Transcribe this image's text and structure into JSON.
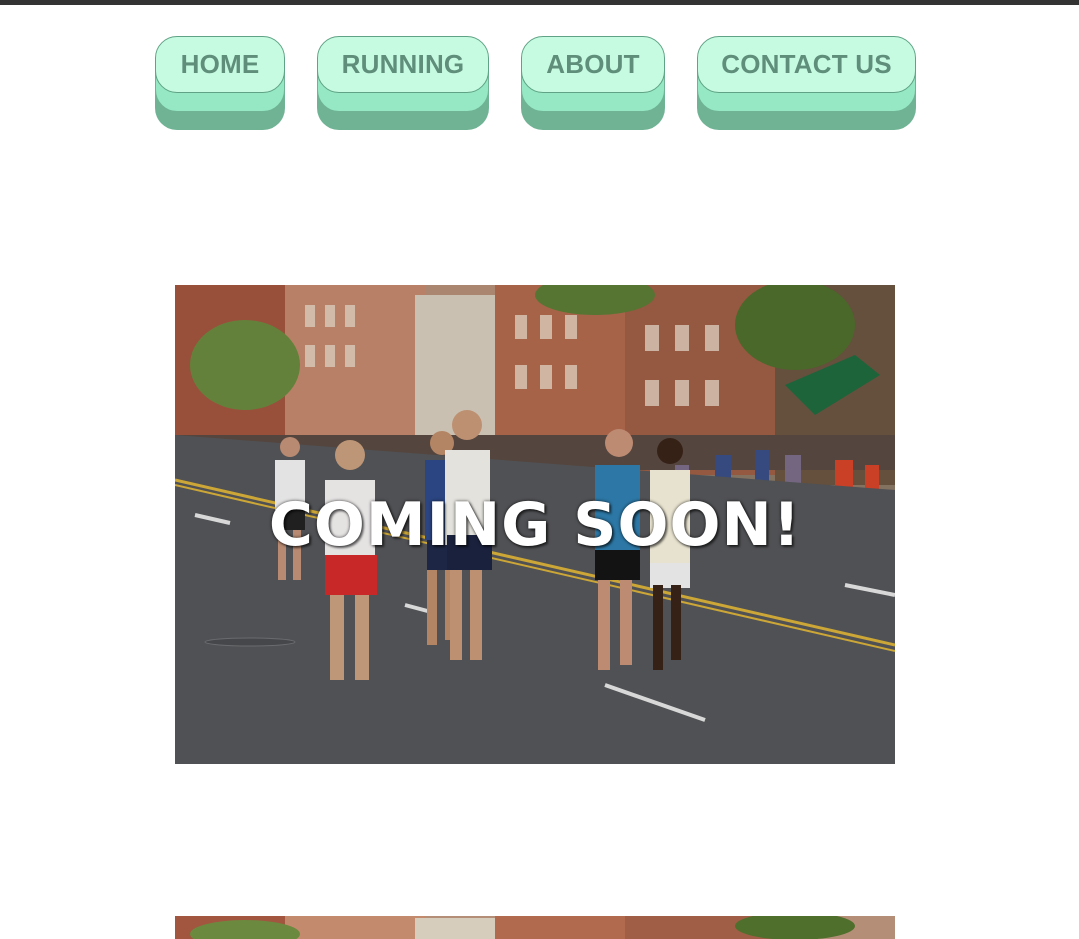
{
  "nav": {
    "items": [
      {
        "label": "HOME"
      },
      {
        "label": "RUNNING"
      },
      {
        "label": "ABOUT"
      },
      {
        "label": "CONTACT US"
      }
    ]
  },
  "hero": {
    "overlay_text": "COMING SOON!",
    "image_description": "marathon-runners-photo"
  },
  "colors": {
    "topbar": "#333333",
    "button_top": "#c6fbe1",
    "button_mid": "#95e8c3",
    "button_bottom": "#6fb394",
    "button_text": "#5f8e7b"
  }
}
